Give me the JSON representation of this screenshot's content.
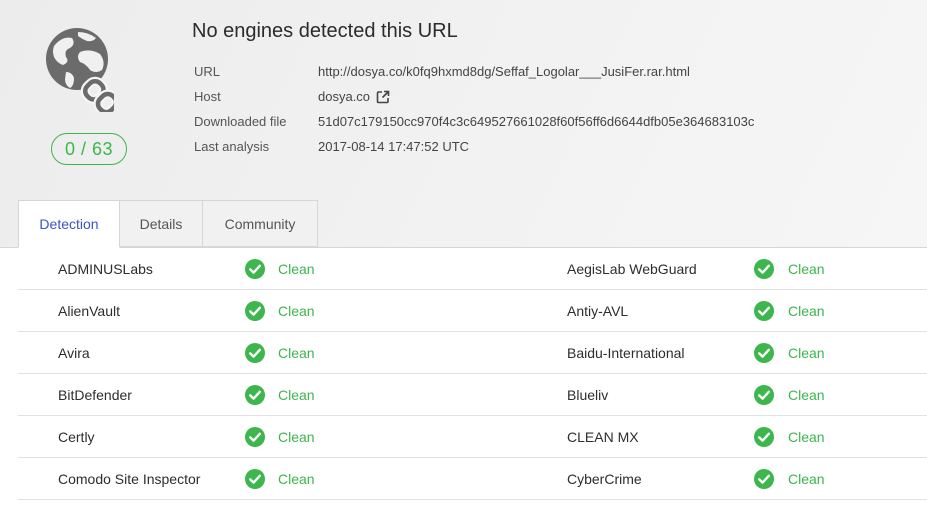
{
  "header": {
    "title": "No engines detected this URL",
    "score": "0 / 63",
    "meta": [
      {
        "key": "URL",
        "value": "http://dosya.co/k0fq9hxmd8dg/Seffaf_Logolar___JusiFer.rar.html"
      },
      {
        "key": "Host",
        "value": "dosya.co"
      },
      {
        "key": "Downloaded file",
        "value": "51d07c179150cc970f4c3c649527661028f60f56ff6d6644dfb05e364683103c"
      },
      {
        "key": "Last analysis",
        "value": "2017-08-14 17:47:52 UTC"
      }
    ]
  },
  "tabs": [
    {
      "label": "Detection",
      "active": true
    },
    {
      "label": "Details",
      "active": false
    },
    {
      "label": "Community",
      "active": false
    }
  ],
  "results": [
    {
      "left": {
        "engine": "ADMINUSLabs",
        "status": "Clean"
      },
      "right": {
        "engine": "AegisLab WebGuard",
        "status": "Clean"
      }
    },
    {
      "left": {
        "engine": "AlienVault",
        "status": "Clean"
      },
      "right": {
        "engine": "Antiy-AVL",
        "status": "Clean"
      }
    },
    {
      "left": {
        "engine": "Avira",
        "status": "Clean"
      },
      "right": {
        "engine": "Baidu-International",
        "status": "Clean"
      }
    },
    {
      "left": {
        "engine": "BitDefender",
        "status": "Clean"
      },
      "right": {
        "engine": "Blueliv",
        "status": "Clean"
      }
    },
    {
      "left": {
        "engine": "Certly",
        "status": "Clean"
      },
      "right": {
        "engine": "CLEAN MX",
        "status": "Clean"
      }
    },
    {
      "left": {
        "engine": "Comodo Site Inspector",
        "status": "Clean"
      },
      "right": {
        "engine": "CyberCrime",
        "status": "Clean"
      }
    }
  ],
  "colors": {
    "clean": "#3cb64d",
    "active_tab": "#3a55c9",
    "icon_gray": "#6b6b6b"
  },
  "icons": {
    "logo": "globe-link-icon",
    "status": "check-circle-icon",
    "external": "external-link-icon"
  }
}
